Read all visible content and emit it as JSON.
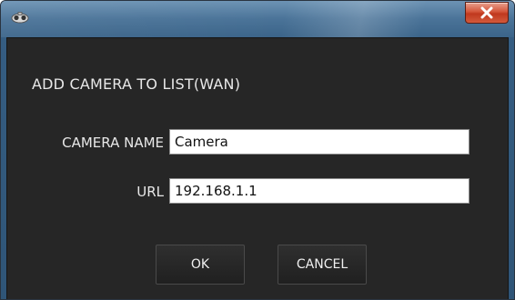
{
  "window": {
    "icon": "camera-icon",
    "close_icon": "close-icon"
  },
  "dialog": {
    "heading": "ADD CAMERA TO LIST(WAN)",
    "camera_name_label": "CAMERA NAME",
    "camera_name_value": "Camera",
    "url_label": "URL",
    "url_value": "192.168.1.1",
    "ok_label": "OK",
    "cancel_label": "CANCEL"
  },
  "colors": {
    "title_bar": "#3f6a90",
    "dialog_bg": "#262626",
    "close_button": "#c0381e",
    "text": "#e8e8e8"
  }
}
